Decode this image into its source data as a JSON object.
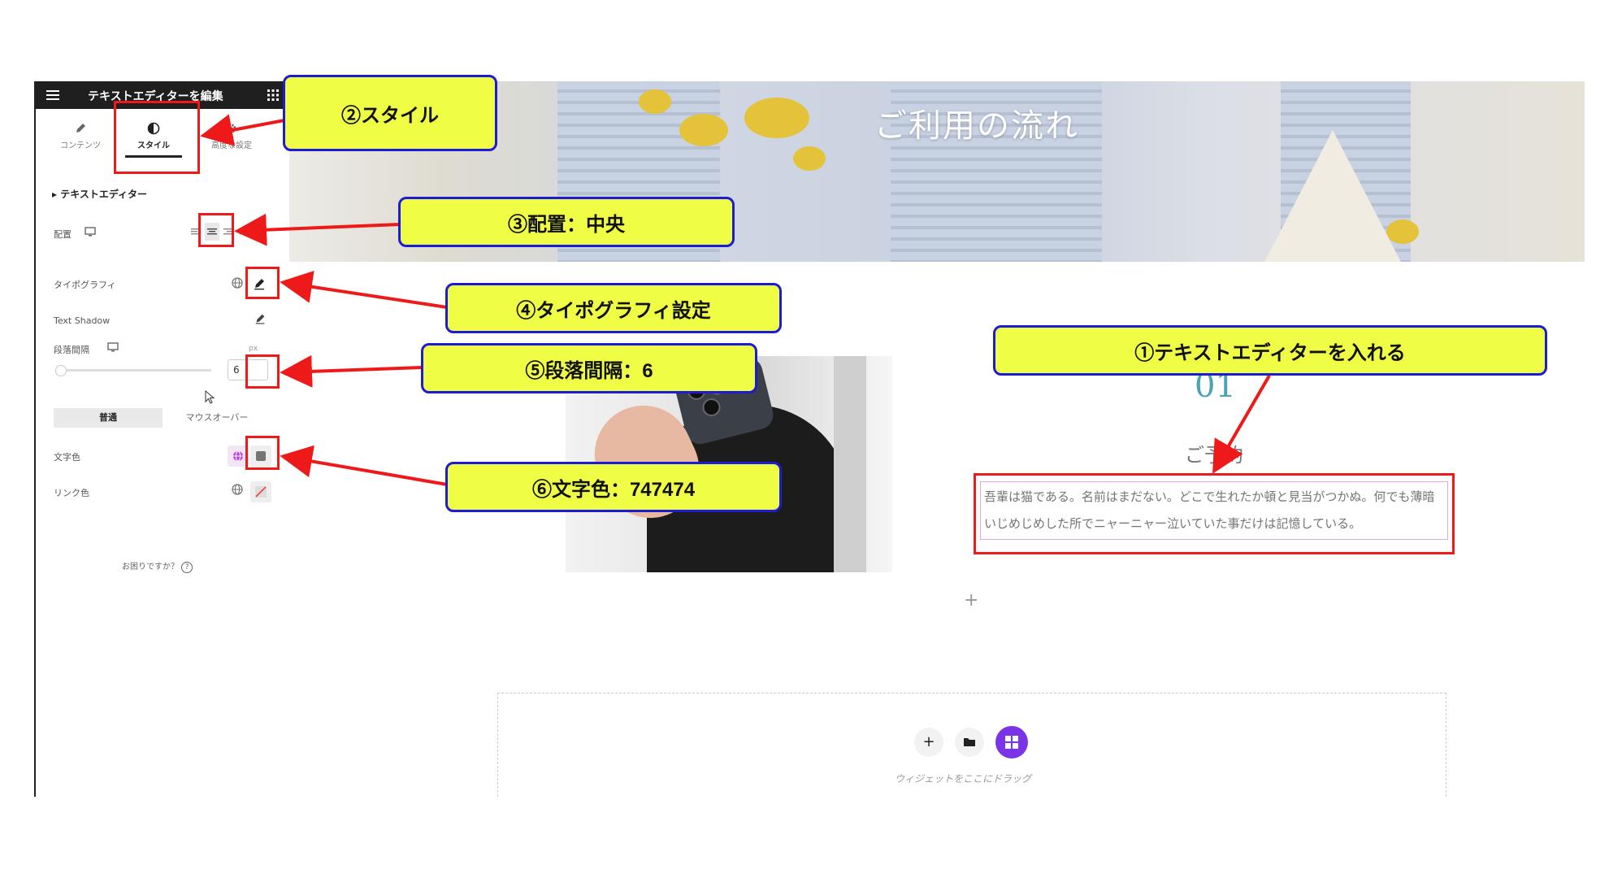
{
  "panel": {
    "title": "テキストエディターを編集",
    "tabs": [
      {
        "label": "コンテンツ",
        "icon": "pencil-icon"
      },
      {
        "label": "スタイル",
        "icon": "half-circle-icon",
        "active": true
      },
      {
        "label": "高度な設定",
        "icon": "gear-icon"
      }
    ],
    "section_title": "テキストエディター",
    "rows": {
      "alignment_label": "配置",
      "typography_label": "タイポグラフィ",
      "text_shadow_label": "Text Shadow",
      "paragraph_spacing_label": "段落間隔",
      "paragraph_spacing_unit": "px",
      "paragraph_spacing_value": "6",
      "state_normal": "普通",
      "state_hover": "マウスオーバー",
      "text_color_label": "文字色",
      "link_color_label": "リンク色"
    },
    "text_color": "#747474",
    "help_text": "お困りですか？"
  },
  "preview": {
    "hero_title": "ご利用の流れ",
    "step_number": "01",
    "step_title": "ご予約",
    "body_text": "吾輩は猫である。名前はまだない。どこで生れたか頓と見当がつかぬ。何でも薄暗いじめじめした所でニャーニャー泣いていた事だけは記憶している。",
    "add_section_symbol": "+",
    "dropzone_hint": "ウィジェットをここにドラッグ"
  },
  "callouts": {
    "c1": "①テキストエディターを入れる",
    "c2": "②スタイル",
    "c3": "③配置：中央",
    "c4": "④タイポグラフィ設定",
    "c5": "⑤段落間隔：6",
    "c6": "⑥文字色：747474"
  },
  "colors": {
    "annotation_red": "#ee1a1a",
    "callout_fill": "#f0fd45",
    "callout_border": "#1b1bd8",
    "accent_teal": "#4aa2b3",
    "widget_purple": "#7a33e6"
  }
}
